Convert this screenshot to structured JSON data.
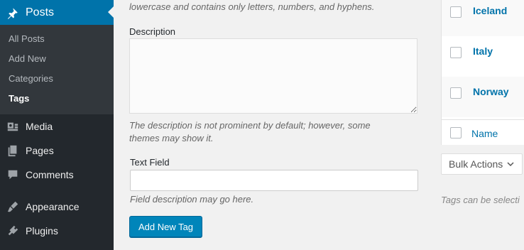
{
  "sidebar": {
    "current_menu": {
      "label": "Posts",
      "icon": "pushpin-icon"
    },
    "submenu": [
      {
        "label": "All Posts",
        "current": false
      },
      {
        "label": "Add New",
        "current": false
      },
      {
        "label": "Categories",
        "current": false
      },
      {
        "label": "Tags",
        "current": true
      }
    ],
    "menu": [
      {
        "label": "Media",
        "icon": "media-icon"
      },
      {
        "label": "Pages",
        "icon": "pages-icon"
      },
      {
        "label": "Comments",
        "icon": "comments-icon"
      },
      {
        "label": "Appearance",
        "icon": "appearance-icon"
      },
      {
        "label": "Plugins",
        "icon": "plugins-icon"
      }
    ]
  },
  "form": {
    "slug_help": "lowercase and contains only letters, numbers, and hyphens.",
    "description_label": "Description",
    "description_value": "",
    "description_help_line1": "The description is not prominent by default; however, some",
    "description_help_line2": "themes may show it.",
    "text_field_label": "Text Field",
    "text_field_value": "",
    "text_field_help": "Field description may go here.",
    "submit_label": "Add New Tag"
  },
  "tags_table": {
    "rows": [
      "Iceland",
      "Italy",
      "Norway"
    ],
    "footer_column": "Name"
  },
  "bulk_actions": {
    "label": "Bulk Actions"
  },
  "right_note": "Tags can be selecti",
  "colors": {
    "sidebar_bg": "#23282d",
    "submenu_bg": "#32373c",
    "accent": "#0073aa",
    "button": "#0085ba"
  }
}
